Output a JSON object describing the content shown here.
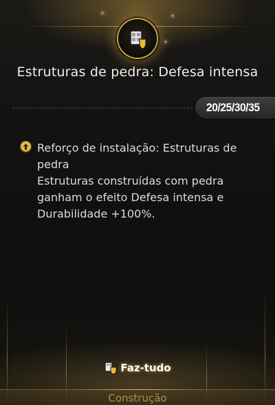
{
  "card": {
    "emblem_icon": "fortify-structure-icon",
    "title": "Estruturas de pedra: Defesa intensa",
    "levels": "20/25/30/35"
  },
  "effect": {
    "icon": "upgrade-arrow-icon",
    "lines": [
      "Reforço de instalação: Estruturas de",
      "pedra",
      "Estruturas construídas com pedra",
      "ganham o efeito Defesa intensa e",
      "Durabilidade +100%."
    ]
  },
  "action": {
    "icon": "toolkit-icon",
    "label": "Faz-tudo"
  },
  "footer": {
    "label": "Construção"
  },
  "colors": {
    "accent_gold": "#c9a24a",
    "footer_text": "#b48e4e",
    "body_text": "#dcdcdc"
  }
}
